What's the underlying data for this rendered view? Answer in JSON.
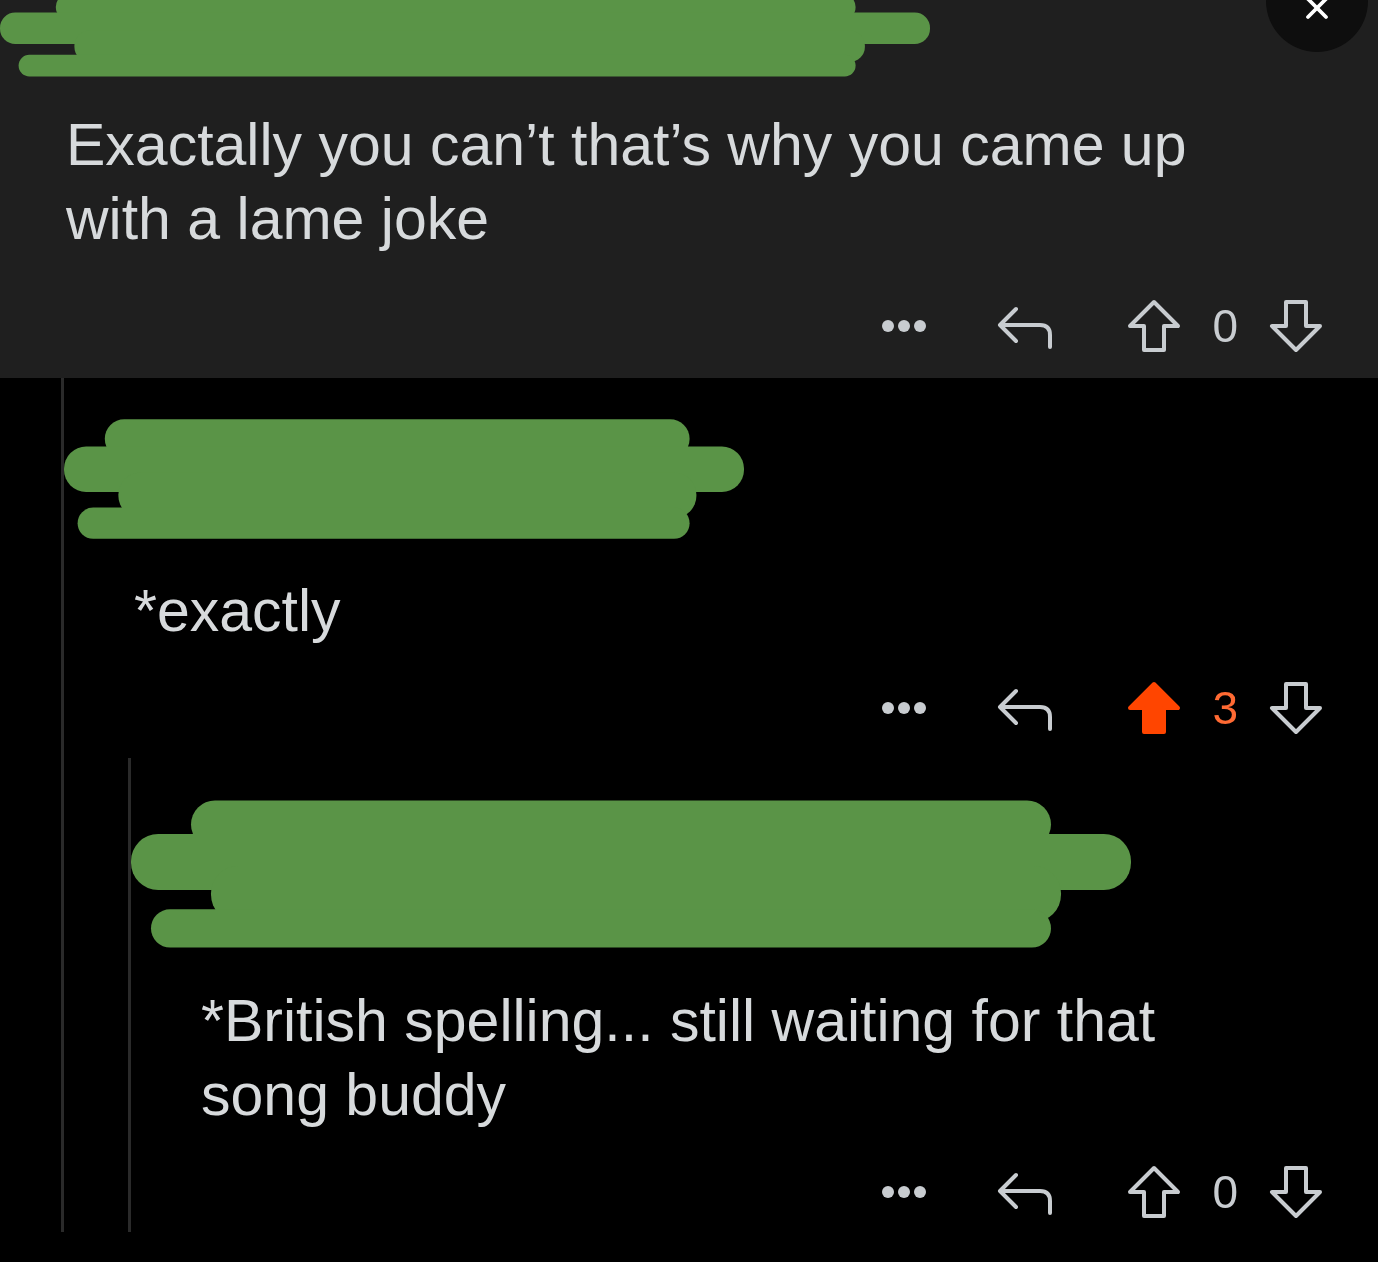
{
  "comment": {
    "text": "Exactally you can’t that’s why you came up with a lame joke",
    "highlighted": true,
    "upvoted": false,
    "score": "0",
    "replies": [
      {
        "text": "*exactly",
        "highlighted": false,
        "upvoted": true,
        "score": "3",
        "replies": [
          {
            "text": "*British spelling... still waiting for that song buddy",
            "highlighted": false,
            "upvoted": false,
            "score": "0"
          }
        ]
      }
    ]
  }
}
